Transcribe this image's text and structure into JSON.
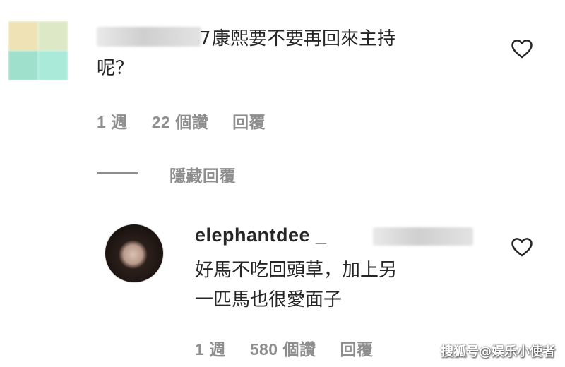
{
  "comment1": {
    "avatar_colors": [
      "#efe3b5",
      "#dde9c6",
      "#9fe0cd",
      "#a9ead9"
    ],
    "username_tail": "7",
    "text_line1": "康熙要不要再回來主持",
    "text_line2": "呢？",
    "time": "1 週",
    "likes": "22 個讚",
    "reply": "回覆",
    "like_icon": "heart-outline-icon"
  },
  "thread": {
    "hide_replies": "隱藏回覆"
  },
  "reply1": {
    "username": "elephantdee _",
    "text_line1": "好馬不吃回頭草，加上另",
    "text_line2": "一匹馬也很愛面子",
    "time": "1 週",
    "likes": "580 個讚",
    "reply": "回覆",
    "like_icon": "heart-outline-icon"
  },
  "watermark": "搜狐号@娱乐小使者"
}
